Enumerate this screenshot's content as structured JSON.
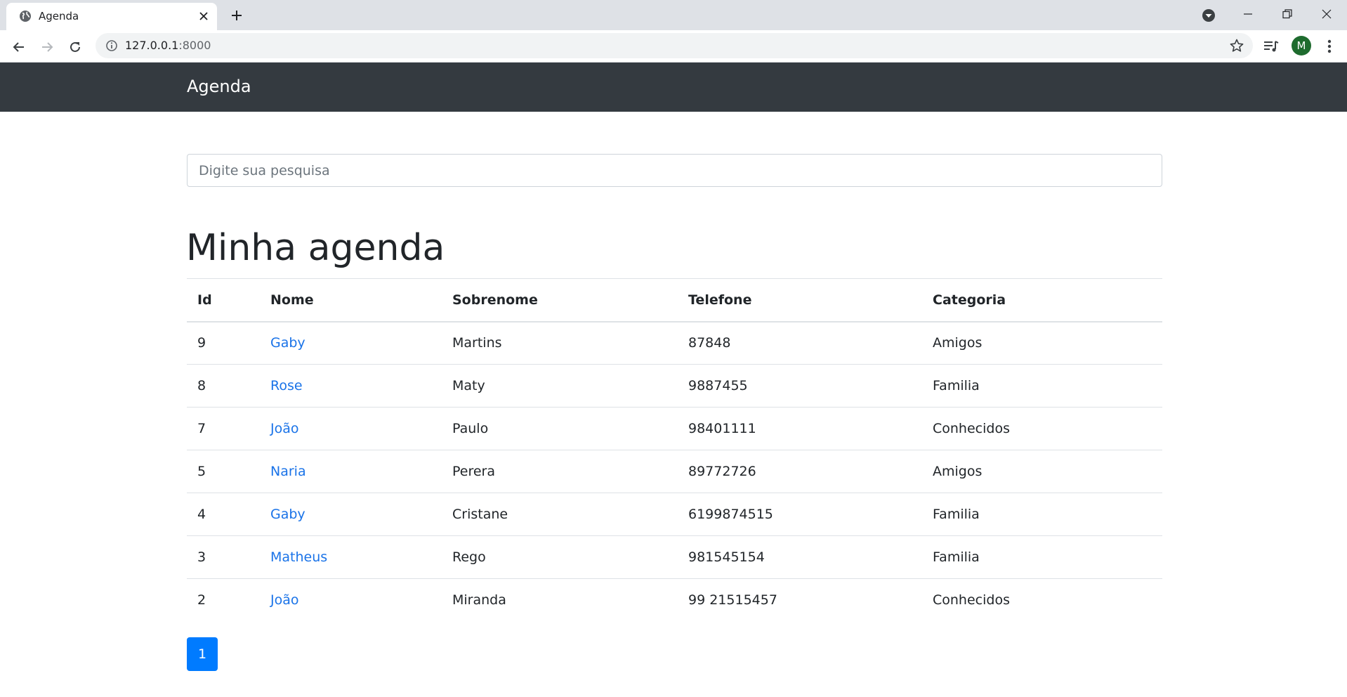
{
  "browser": {
    "tab": {
      "title": "Agenda",
      "favicon": "globe-icon"
    },
    "address": {
      "host": "127.0.0.1",
      "port": ":8000"
    },
    "profile_initial": "M",
    "colors": {
      "tabstrip": "#dee1e6",
      "avatar": "#1e6b2e"
    }
  },
  "navbar": {
    "brand": "Agenda",
    "color": "#343a40"
  },
  "search": {
    "placeholder": "Digite sua pesquisa"
  },
  "main": {
    "title": "Minha agenda",
    "columns": [
      "Id",
      "Nome",
      "Sobrenome",
      "Telefone",
      "Categoria"
    ],
    "rows": [
      {
        "id": "9",
        "nome": "Gaby",
        "sobrenome": "Martins",
        "telefone": "87848",
        "categoria": "Amigos"
      },
      {
        "id": "8",
        "nome": "Rose",
        "sobrenome": "Maty",
        "telefone": "9887455",
        "categoria": "Familia"
      },
      {
        "id": "7",
        "nome": "João",
        "sobrenome": "Paulo",
        "telefone": "98401111",
        "categoria": "Conhecidos"
      },
      {
        "id": "5",
        "nome": "Naria",
        "sobrenome": "Perera",
        "telefone": "89772726",
        "categoria": "Amigos"
      },
      {
        "id": "4",
        "nome": "Gaby",
        "sobrenome": "Cristane",
        "telefone": "6199874515",
        "categoria": "Familia"
      },
      {
        "id": "3",
        "nome": "Matheus",
        "sobrenome": "Rego",
        "telefone": "981545154",
        "categoria": "Familia"
      },
      {
        "id": "2",
        "nome": "João",
        "sobrenome": "Miranda",
        "telefone": "99 21515457",
        "categoria": "Conhecidos"
      }
    ],
    "link_color": "#1a73e8"
  },
  "pagination": {
    "current": "1",
    "color": "#007bff"
  }
}
